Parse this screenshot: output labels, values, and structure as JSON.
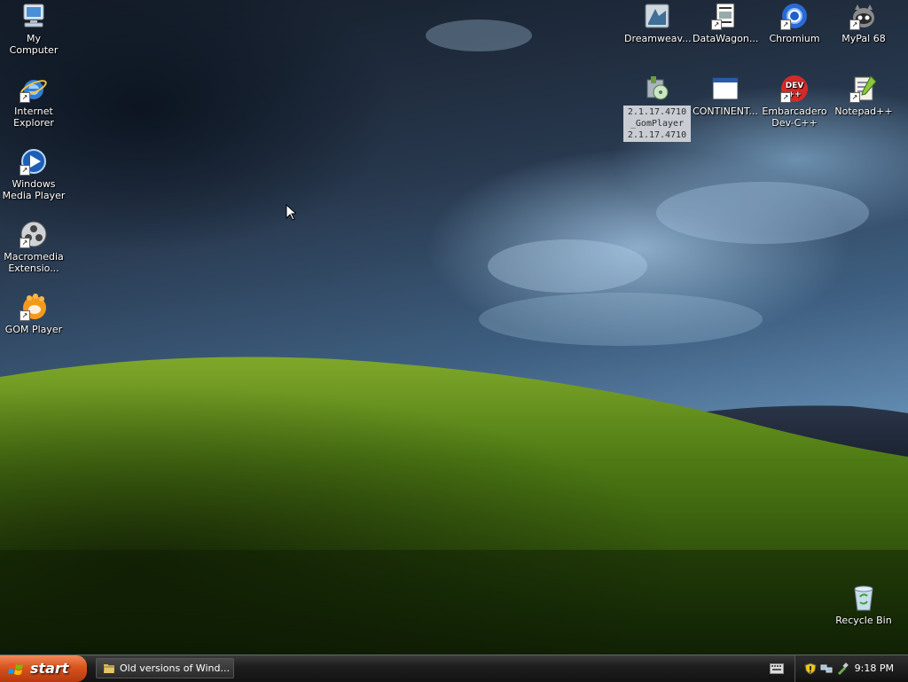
{
  "desktop": {
    "left_icons": [
      {
        "label": "My Computer"
      },
      {
        "label": "Internet Explorer"
      },
      {
        "label": "Windows Media Player"
      },
      {
        "label": "Macromedia Extensio..."
      },
      {
        "label": "GOM Player"
      }
    ],
    "right_icons_row1": [
      {
        "label": "Dreamweav..."
      },
      {
        "label": "DataWagon..."
      },
      {
        "label": "Chromium"
      },
      {
        "label": "MyPal 68"
      }
    ],
    "right_icons_row2": [
      {
        "label": "2.1.17.4710_GomPlayer2.1.17.4710",
        "selected": true
      },
      {
        "label": "CONTINENT..."
      },
      {
        "label": "Embarcadero Dev-C++"
      },
      {
        "label": "Notepad++"
      }
    ],
    "recycle_bin": {
      "label": "Recycle Bin"
    },
    "dev_badge_text": "DEV",
    "dev_badge_plus": "++"
  },
  "taskbar": {
    "start_label": "start",
    "task_button_label": "Old versions of Wind...",
    "clock": "9:18 PM"
  },
  "icons": {
    "my_computer": "computer-icon",
    "internet_explorer": "ie-icon",
    "media_player": "media-player-icon",
    "macromedia": "macromedia-icon",
    "gom": "gom-icon",
    "dreamweaver": "dreamweaver-icon",
    "datawagon": "datawagon-icon",
    "chromium": "chromium-icon",
    "mypal": "mypal-icon",
    "installer": "installer-icon",
    "continent": "window-icon",
    "devcpp": "devcpp-icon",
    "notepadpp": "notepadpp-icon",
    "recycle": "recycle-bin-icon"
  },
  "colors": {
    "start_button": "#d9531e",
    "taskbar": "#1e1e1e",
    "selected_label_bg": "#c9cdd3"
  }
}
